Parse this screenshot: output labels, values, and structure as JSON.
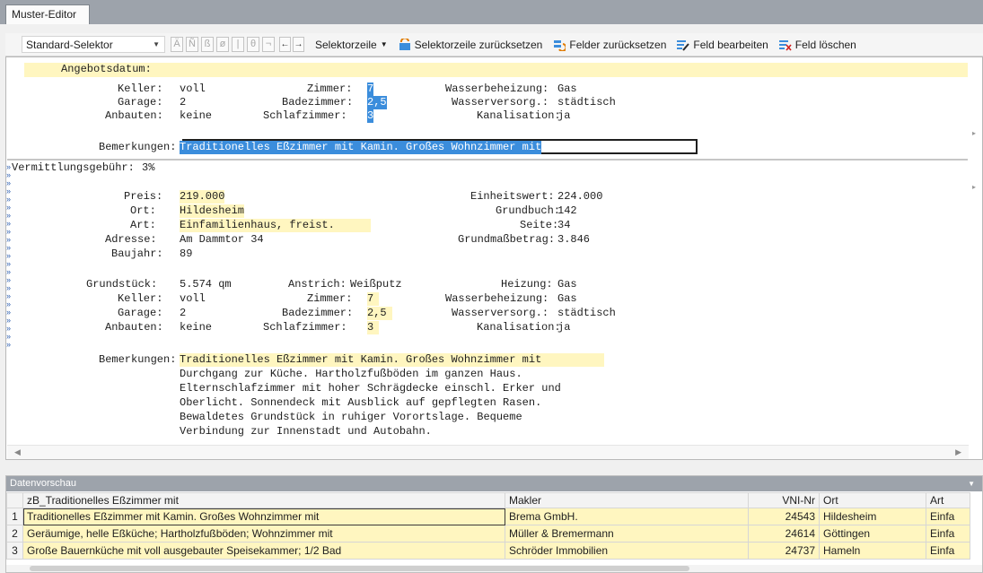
{
  "tab": {
    "title": "Muster-Editor"
  },
  "toolbar": {
    "selector_value": "Standard-Selektor",
    "special_chars": [
      "Ä",
      "Ñ",
      "ß",
      "ø",
      "|",
      "θ",
      "¬"
    ],
    "nav_prev": "←",
    "nav_next": "→",
    "selektorzeile": "Selektorzeile",
    "reset_row": "Selektorzeile zurücksetzen",
    "reset_fields": "Felder zurücksetzen",
    "edit_field": "Feld bearbeiten",
    "delete_field": "Feld löschen"
  },
  "editor": {
    "header_line": "Angebotsdatum:",
    "upper_lines": [
      {
        "label": "Keller:",
        "value": "voll",
        "l2": "Zimmer:",
        "v2": "7",
        "l3": "Wasserbeheizung:",
        "v3": "Gas"
      },
      {
        "label": "Garage:",
        "value": "2",
        "l2": "Badezimmer:",
        "v2": "2,5",
        "l3": "Wasserversorg.:",
        "v3": "städtisch"
      },
      {
        "label": "Anbauten:",
        "value": "keine",
        "l2": "Schlafzimmer:",
        "v2": "3",
        "l3": "Kanalisation:",
        "v3": "ja"
      }
    ],
    "upper_remarks_label": "Bemerkungen:",
    "upper_remarks_value": "Traditionelles Eßzimmer mit Kamin. Großes Wohnzimmer mit",
    "fee_label": "Vermittlungsgebühr:",
    "fee_value": "3%",
    "price_label": "Preis:",
    "price_value": "219.000",
    "unit_label": "Einheitswert:",
    "unit_value": "224.000",
    "city_label": "Ort:",
    "city_value": "Hildesheim",
    "book_label": "Grundbuch:",
    "book_value": "142",
    "type_label": "Art:",
    "type_value": "Einfamilienhaus, freist.",
    "page_label": "Seite:",
    "page_value": "34",
    "addr_label": "Adresse:",
    "addr_value": "Am Dammtor 34",
    "base_label": "Grundmaßbetrag:",
    "base_value": "3.846",
    "year_label": "Baujahr:",
    "year_value": "89",
    "plot_label": "Grundstück:",
    "plot_value": "5.574 qm",
    "paint_label": "Anstrich:",
    "paint_value": "Weißputz",
    "heat_label": "Heizung:",
    "heat_value": "Gas",
    "lower_lines": [
      {
        "label": "Keller:",
        "value": "voll",
        "l2": "Zimmer:",
        "v2": "7",
        "l3": "Wasserbeheizung:",
        "v3": "Gas"
      },
      {
        "label": "Garage:",
        "value": "2",
        "l2": "Badezimmer:",
        "v2": "2,5",
        "l3": "Wasserversorg.:",
        "v3": "städtisch"
      },
      {
        "label": "Anbauten:",
        "value": "keine",
        "l2": "Schlafzimmer:",
        "v2": "3",
        "l3": "Kanalisation:",
        "v3": "ja"
      }
    ],
    "remarks_label": "Bemerkungen:",
    "remarks_lines": [
      "Traditionelles Eßzimmer mit Kamin. Großes Wohnzimmer mit",
      "Durchgang zur Küche. Hartholzfußböden im ganzen Haus.",
      "Elternschlafzimmer mit hoher Schrägdecke einschl. Erker und",
      "Oberlicht. Sonnendeck mit Ausblick auf gepflegten Rasen.",
      "Bewaldetes Grundstück in ruhiger Vorortslage. Bequeme",
      "Verbindung zur Innenstadt und Autobahn."
    ]
  },
  "preview": {
    "title": "Datenvorschau",
    "columns": [
      "zB_Traditionelles Eßzimmer mit",
      "Makler",
      "VNI-Nr",
      "Ort",
      "Art"
    ],
    "rows": [
      {
        "n": "1",
        "a": "Traditionelles Eßzimmer mit Kamin. Großes Wohnzimmer mit",
        "b": "Brema GmbH.",
        "c": "24543",
        "d": "Hildesheim",
        "e": "Einfa"
      },
      {
        "n": "2",
        "a": "Geräumige, helle Eßküche; Hartholzfußböden; Wohnzimmer mit",
        "b": "Müller & Bremermann",
        "c": "24614",
        "d": "Göttingen",
        "e": "Einfa"
      },
      {
        "n": "3",
        "a": "Große Bauernküche mit voll ausgebauter Speisekammer; 1/2 Bad",
        "b": "Schröder Immobilien",
        "c": "24737",
        "d": "Hameln",
        "e": "Einfa"
      }
    ]
  }
}
